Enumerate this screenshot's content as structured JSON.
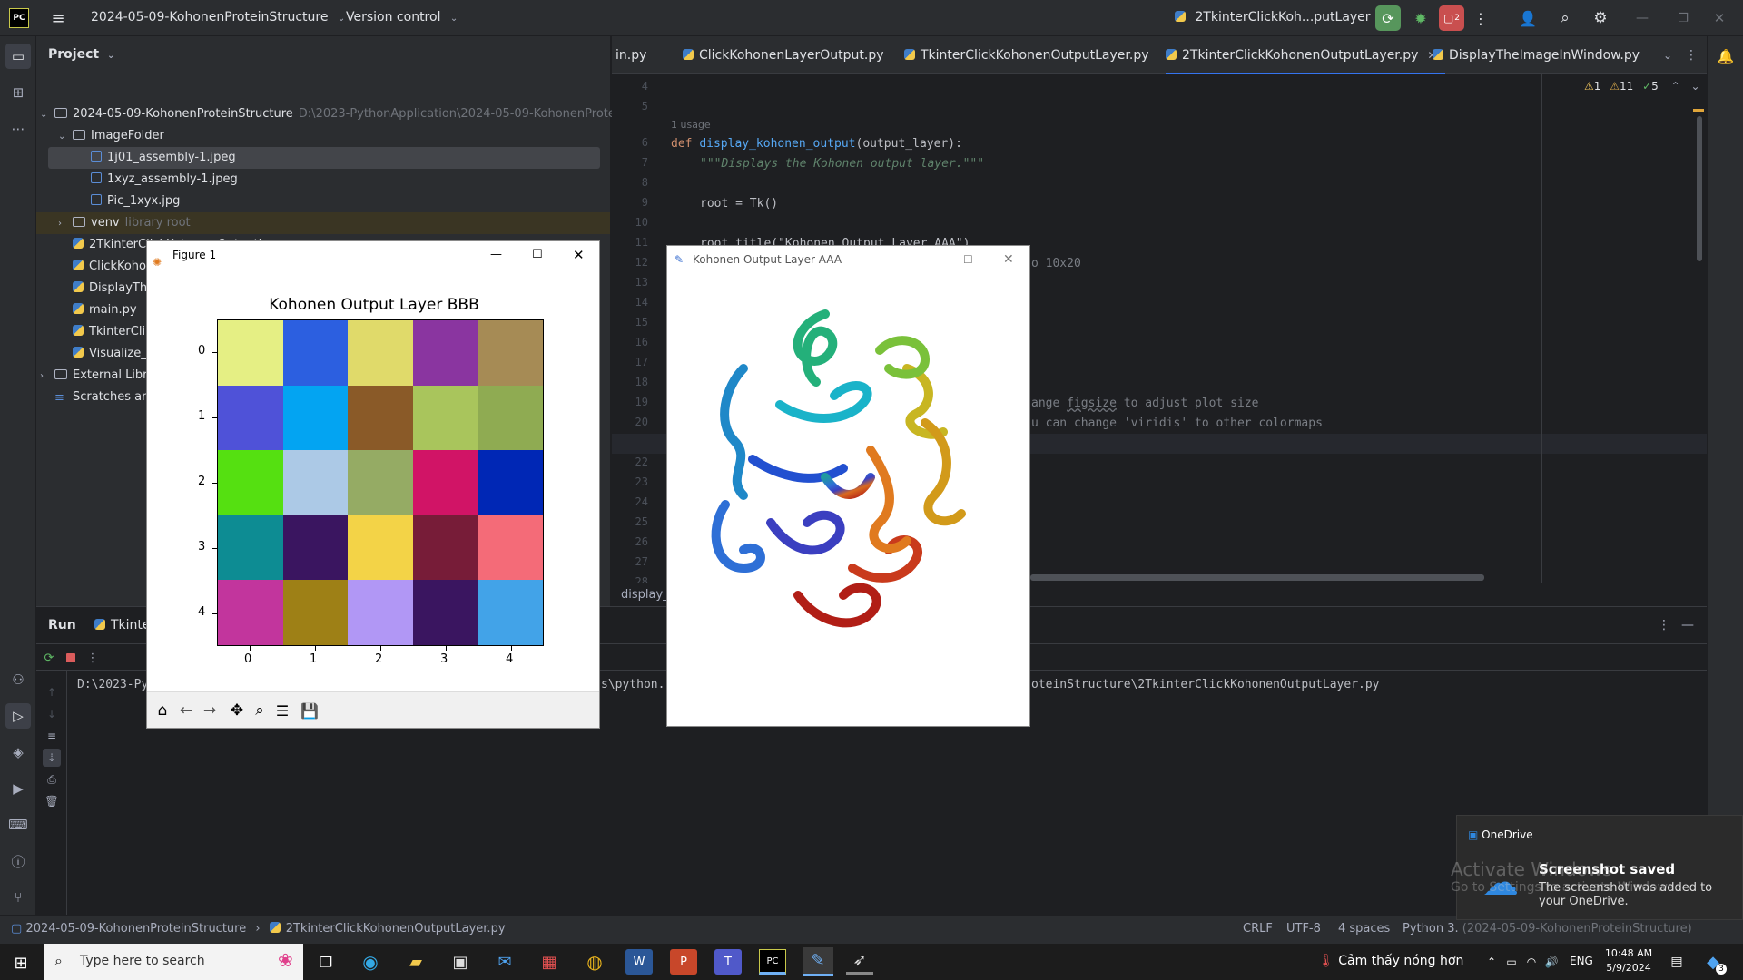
{
  "titlebar": {
    "project_name": "2024-05-09-KohonenProteinStructure",
    "vcs": "Version control",
    "run_config": "2TkinterClickKoh...putLayer",
    "badge_count": "2"
  },
  "project_panel": {
    "title": "Project",
    "tree": [
      {
        "label": "2024-05-09-KohonenProteinStructure",
        "extra": "D:\\2023-PythonApplication\\2024-05-09-KohonenProte",
        "kind": "folder",
        "depth": 0,
        "expanded": true
      },
      {
        "label": "ImageFolder",
        "extra": "",
        "kind": "folder",
        "depth": 1,
        "expanded": true
      },
      {
        "label": "1j01_assembly-1.jpeg",
        "extra": "",
        "kind": "image",
        "depth": 2,
        "selected": true
      },
      {
        "label": "1xyz_assembly-1.jpeg",
        "extra": "",
        "kind": "image",
        "depth": 2
      },
      {
        "label": "Pic_1xyx.jpg",
        "extra": "",
        "kind": "image",
        "depth": 2
      },
      {
        "label": "venv",
        "extra": "library root",
        "kind": "folder",
        "depth": 1,
        "expanded": false
      },
      {
        "label": "2TkinterClickKohonenOutputLayer.py",
        "extra": "",
        "kind": "py",
        "depth": 1
      },
      {
        "label": "ClickKohonenLayerOutput",
        "extra": "",
        "kind": "py",
        "depth": 1
      },
      {
        "label": "DisplayTh",
        "extra": "",
        "kind": "py",
        "depth": 1
      },
      {
        "label": "main.py",
        "extra": "",
        "kind": "py",
        "depth": 1
      },
      {
        "label": "TkinterCli",
        "extra": "",
        "kind": "py",
        "depth": 1
      },
      {
        "label": "Visualize_",
        "extra": "",
        "kind": "py",
        "depth": 1
      },
      {
        "label": "External Libr",
        "extra": "",
        "kind": "lib",
        "depth": 0
      },
      {
        "label": "Scratches an",
        "extra": "",
        "kind": "scratch",
        "depth": 0
      }
    ]
  },
  "editor": {
    "tabs": [
      {
        "label": "in.py",
        "active": false
      },
      {
        "label": "ClickKohonenLayerOutput.py",
        "active": false
      },
      {
        "label": "TkinterClickKohonenOutputLayer.py",
        "active": false
      },
      {
        "label": "2TkinterClickKohonenOutputLayer.py",
        "active": true
      },
      {
        "label": "DisplayTheImageInWindow.py",
        "active": false
      }
    ],
    "inspections": {
      "warn1": "1",
      "warn2": "11",
      "ok": "5"
    },
    "usage_hint": "1 usage",
    "line_numbers": [
      "4",
      "5",
      "6",
      "7",
      "8",
      "9",
      "10",
      "11",
      "12",
      "13",
      "14",
      "15",
      "16",
      "17",
      "18",
      "19",
      "20",
      "21",
      "22",
      "23",
      "24",
      "25",
      "26",
      "27",
      "28"
    ],
    "code": {
      "def_kw": "def",
      "fn_name": "display_kohonen_output",
      "fn_params": "(output_layer):",
      "docstring": "\"\"\"Displays the Kohonen output layer.\"\"\"",
      "root_line": "root = Tk()",
      "title_line": "root.title(\"Kohonen Output Layer AAA\")",
      "frag_size": "o 10x20",
      "frag_figsize_pre": "ange ",
      "frag_figsize_word": "figsize",
      "frag_figsize_post": " to adjust plot size",
      "frag_viridis": "u can change 'viridis' to other colormaps"
    },
    "breadcrumb": "display_"
  },
  "run_panel": {
    "title": "Run",
    "tab": "Tkinte",
    "console_left": "D:\\2023-Py",
    "console_mid": "s\\python.",
    "console_right": "oteinStructure\\2TkinterClickKohonenOutputLayer.py"
  },
  "figure_window": {
    "title": "Figure 1"
  },
  "chart_data": {
    "type": "heatmap",
    "title": "Kohonen Output Layer BBB",
    "x_ticks": [
      "0",
      "1",
      "2",
      "3",
      "4"
    ],
    "y_ticks": [
      "0",
      "1",
      "2",
      "3",
      "4"
    ],
    "cells": [
      [
        "#e5ef84",
        "#2c5fe0",
        "#e0da6a",
        "#8a35a0",
        "#a68b55"
      ],
      [
        "#4f52d8",
        "#03a4f2",
        "#8a5a28",
        "#a9c55c",
        "#8fab52"
      ],
      [
        "#55e011",
        "#acc9e6",
        "#95ab64",
        "#d11466",
        "#0027b5"
      ],
      [
        "#0d8c93",
        "#3a1560",
        "#f3d347",
        "#771c38",
        "#f46b78"
      ],
      [
        "#c2359d",
        "#9e8016",
        "#b197f5",
        "#3a1560",
        "#42a3e8"
      ]
    ]
  },
  "kohonen_window": {
    "title": "Kohonen Output Layer AAA"
  },
  "statusbar": {
    "path_project": "2024-05-09-KohonenProteinStructure",
    "path_file": "2TkinterClickKohonenOutputLayer.py",
    "line_sep": "CRLF",
    "encoding": "UTF-8",
    "indent": "4 spaces",
    "interpreter": "Python 3.",
    "interpreter_rest": "(2024-05-09-KohonenProteinStructure)"
  },
  "toast": {
    "app": "OneDrive",
    "title": "Screenshot saved",
    "body": "The screenshot was added to your OneDrive.",
    "watermark_1": "Activate Windows",
    "watermark_2": "Go to Settings to activate Windows."
  },
  "taskbar": {
    "search_placeholder": "Type here to search",
    "weather": "Cảm thấy nóng hơn",
    "lang": "ENG",
    "time": "10:48 AM",
    "date": "5/9/2024",
    "notif_count": "3"
  }
}
